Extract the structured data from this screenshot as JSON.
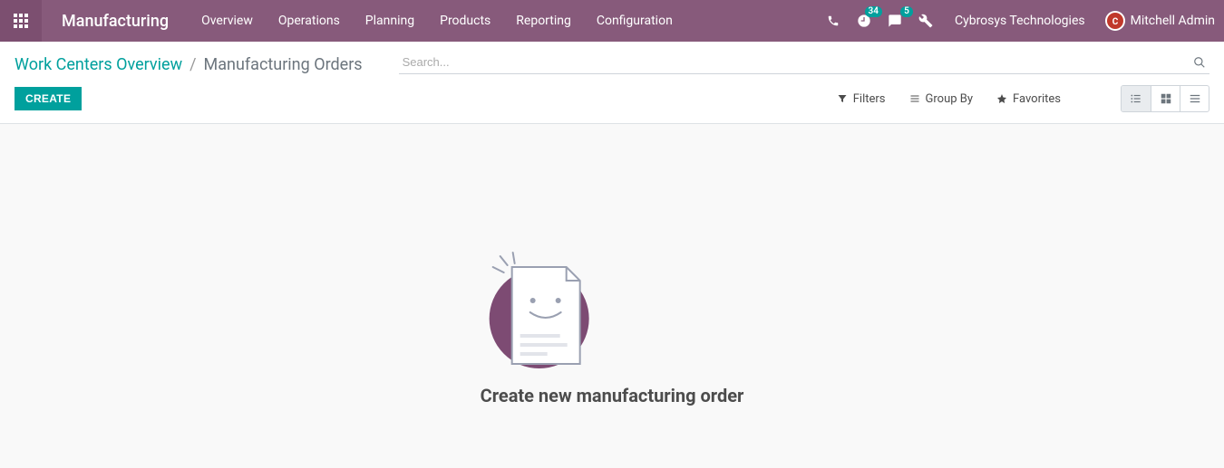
{
  "navbar": {
    "brand": "Manufacturing",
    "menu": [
      "Overview",
      "Operations",
      "Planning",
      "Products",
      "Reporting",
      "Configuration"
    ],
    "clock_badge": "34",
    "chat_badge": "5",
    "company": "Cybrosys Technologies",
    "user": "Mitchell Admin"
  },
  "breadcrumb": {
    "link": "Work Centers Overview",
    "current": "Manufacturing Orders"
  },
  "search": {
    "placeholder": "Search..."
  },
  "buttons": {
    "create": "CREATE",
    "filters": "Filters",
    "groupby": "Group By",
    "favorites": "Favorites"
  },
  "empty": {
    "title": "Create new manufacturing order"
  }
}
